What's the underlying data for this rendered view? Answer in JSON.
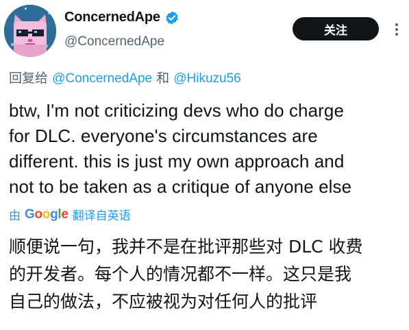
{
  "author": {
    "display_name": "ConcernedApe",
    "handle": "@ConcernedApe",
    "verified": true,
    "avatar_icon": "pixel-cat-avatar-icon"
  },
  "actions": {
    "follow_label": "关注",
    "more_icon": "more-vertical-icon"
  },
  "reply": {
    "prefix": "回复给",
    "mention_1": "@ConcernedApe",
    "conjunction": "和",
    "mention_2": "@Hikuzu56"
  },
  "tweet": {
    "lines": [
      "btw, I'm not criticizing devs who do charge",
      "for DLC. everyone's circumstances are",
      "different. this is just my own approach and",
      "not to be taken as a critique of anyone else"
    ]
  },
  "translation": {
    "prefix": "由",
    "provider": "Google",
    "suffix": "翻译自英语",
    "lines": [
      "顺便说一句，我并不是在批评那些对 DLC 收费",
      "的开发者。每个人的情况都不一样。这只是我",
      "自己的做法，不应被视为对任何人的批评"
    ]
  },
  "colors": {
    "accent": "#1d9bf0",
    "text": "#0f1419",
    "secondary": "#536471",
    "button_bg": "#0f1419",
    "google_blue": "#4285f4",
    "google_red": "#ea4335",
    "google_yellow": "#fbbc05",
    "google_green": "#34a853"
  }
}
